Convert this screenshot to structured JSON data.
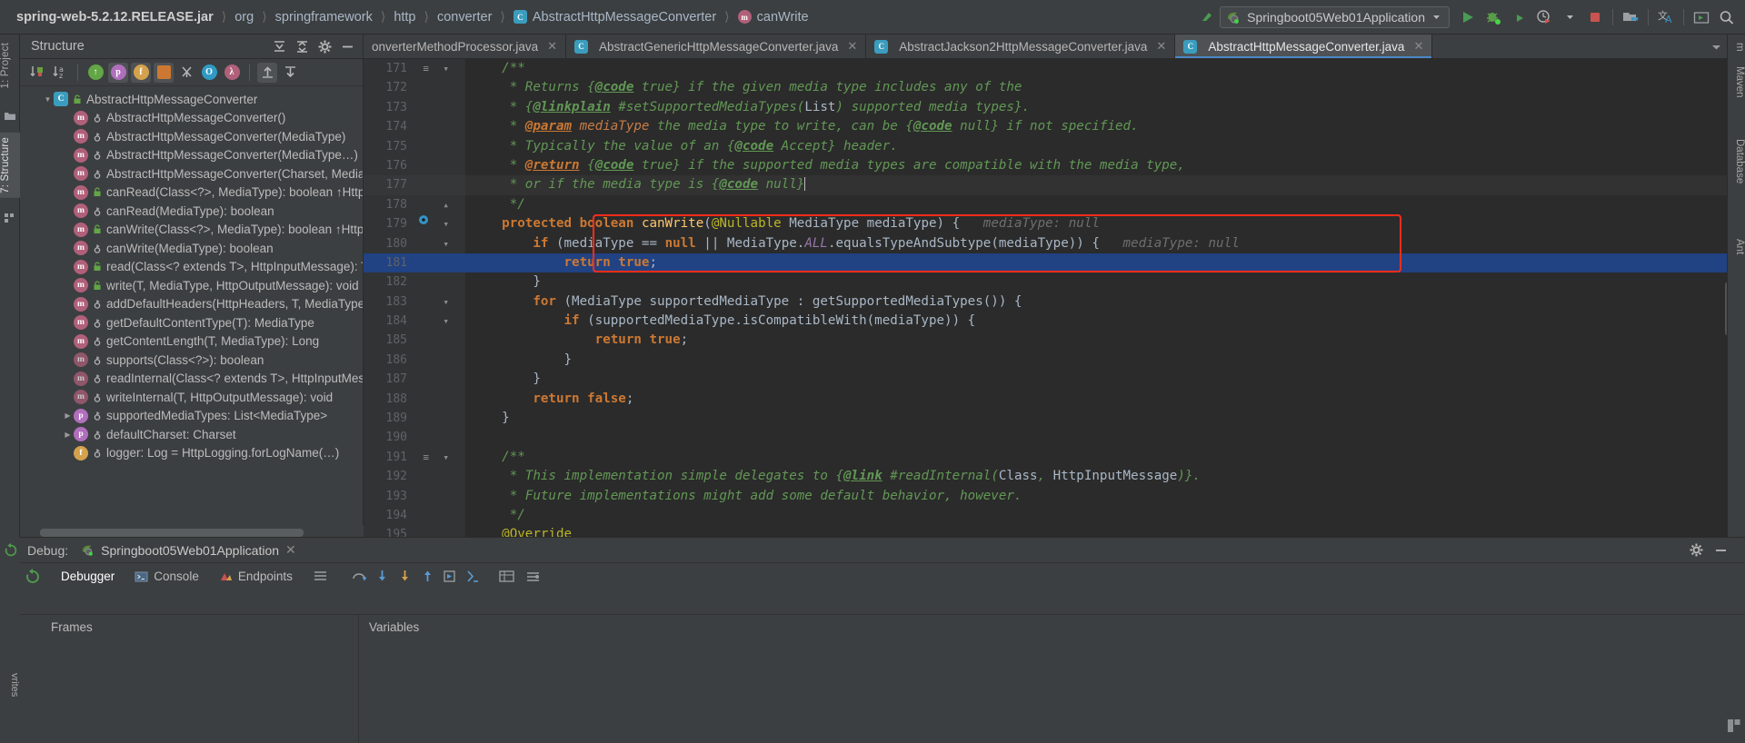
{
  "navbar": {
    "breadcrumbs": [
      {
        "label": "spring-web-5.2.12.RELEASE.jar",
        "icon": "",
        "bold": true
      },
      {
        "label": "org",
        "icon": ""
      },
      {
        "label": "springframework",
        "icon": ""
      },
      {
        "label": "http",
        "icon": ""
      },
      {
        "label": "converter",
        "icon": ""
      },
      {
        "label": "AbstractHttpMessageConverter",
        "icon": "class-icon"
      },
      {
        "label": "canWrite",
        "icon": "method-icon"
      }
    ],
    "run_config": "Springboot05Web01Application",
    "buttons": [
      {
        "name": "back-arrow-icon"
      },
      {
        "name": "run-button",
        "label": "Run"
      },
      {
        "name": "debug-button",
        "label": "Debug"
      },
      {
        "name": "run-coverage-button",
        "label": "Run with Coverage"
      },
      {
        "name": "profiler-button",
        "label": "Profiler"
      },
      {
        "name": "stop-button",
        "label": "Stop"
      },
      {
        "name": "project-structure-button",
        "label": "Project Structure"
      },
      {
        "name": "translate-button",
        "label": "Translate"
      },
      {
        "name": "terminal-button",
        "label": "Terminal"
      },
      {
        "name": "search-everywhere-button",
        "label": "Search"
      }
    ]
  },
  "left_tool_strip": [
    {
      "label": "1: Project",
      "selected": false
    },
    {
      "label": "7: Structure",
      "selected": true
    }
  ],
  "right_tool_strip": [
    {
      "label": "m",
      "selected": false
    },
    {
      "label": "Maven",
      "selected": false
    },
    {
      "label": "Database",
      "selected": false
    },
    {
      "label": "Ant",
      "selected": false
    }
  ],
  "structure": {
    "title": "Structure",
    "header_icons": [
      "expand-all-icon",
      "collapse-all-icon",
      "settings-icon",
      "hide-icon"
    ],
    "toolbar_icons": [
      "sort-by-visibility-icon",
      "sort-alphabetically-icon",
      "show-inherited-icon",
      "show-properties-icon",
      "show-fields-icon",
      "show-non-public-icon",
      "show-anonymous-icon",
      "show-interfaces-icon",
      "show-lambdas-icon",
      "expand-all-icon",
      "collapse-all-icon"
    ],
    "root": {
      "label": "AbstractHttpMessageConverter",
      "icon": "class-icon",
      "expanded": true
    },
    "items": [
      {
        "label": "AbstractHttpMessageConverter()",
        "icon": "method-icon",
        "vis": "protected",
        "indent": 1
      },
      {
        "label": "AbstractHttpMessageConverter(MediaType)",
        "icon": "method-icon",
        "vis": "protected",
        "indent": 1
      },
      {
        "label": "AbstractHttpMessageConverter(MediaType…)",
        "icon": "method-icon",
        "vis": "protected",
        "indent": 1
      },
      {
        "label": "AbstractHttpMessageConverter(Charset, MediaTyp",
        "icon": "method-icon",
        "vis": "protected",
        "indent": 1
      },
      {
        "label": "canRead(Class<?>, MediaType): boolean ↑HttpMes",
        "icon": "method-icon",
        "vis": "public",
        "indent": 1
      },
      {
        "label": "canRead(MediaType): boolean",
        "icon": "method-icon",
        "vis": "protected",
        "indent": 1
      },
      {
        "label": "canWrite(Class<?>, MediaType): boolean ↑HttpMes",
        "icon": "method-icon",
        "vis": "public",
        "indent": 1
      },
      {
        "label": "canWrite(MediaType): boolean",
        "icon": "method-icon",
        "vis": "protected",
        "indent": 1
      },
      {
        "label": "read(Class<? extends T>, HttpInputMessage): T ↑H",
        "icon": "method-icon",
        "vis": "public",
        "indent": 1
      },
      {
        "label": "write(T, MediaType, HttpOutputMessage): void ↑H",
        "icon": "method-icon",
        "vis": "public",
        "indent": 1
      },
      {
        "label": "addDefaultHeaders(HttpHeaders, T, MediaType): v",
        "icon": "method-icon",
        "vis": "protected",
        "indent": 1
      },
      {
        "label": "getDefaultContentType(T): MediaType",
        "icon": "method-icon",
        "vis": "protected",
        "indent": 1
      },
      {
        "label": "getContentLength(T, MediaType): Long",
        "icon": "method-icon",
        "vis": "protected",
        "indent": 1
      },
      {
        "label": "supports(Class<?>): boolean",
        "icon": "method-abstract-icon",
        "vis": "protected",
        "indent": 1
      },
      {
        "label": "readInternal(Class<? extends T>, HttpInputMessage",
        "icon": "method-abstract-icon",
        "vis": "protected",
        "indent": 1
      },
      {
        "label": "writeInternal(T, HttpOutputMessage): void",
        "icon": "method-abstract-icon",
        "vis": "protected",
        "indent": 1
      },
      {
        "label": "supportedMediaTypes: List<MediaType>",
        "icon": "property-icon",
        "vis": "private",
        "indent": 1,
        "arrow": true
      },
      {
        "label": "defaultCharset: Charset",
        "icon": "property-icon",
        "vis": "private",
        "indent": 1,
        "arrow": true
      },
      {
        "label": "logger: Log = HttpLogging.forLogName(…)",
        "icon": "field-icon",
        "vis": "protected",
        "indent": 1
      }
    ]
  },
  "editor": {
    "tabs": [
      {
        "label": "onverterMethodProcessor.java",
        "icon": "",
        "active": false,
        "closable": true
      },
      {
        "label": "AbstractGenericHttpMessageConverter.java",
        "icon": "class-icon",
        "active": false,
        "closable": true
      },
      {
        "label": "AbstractJackson2HttpMessageConverter.java",
        "icon": "class-icon",
        "active": false,
        "closable": true
      },
      {
        "label": "AbstractHttpMessageConverter.java",
        "icon": "class-icon",
        "active": true,
        "closable": true
      }
    ],
    "first_line": 171,
    "selected_line": 181,
    "lines": [
      {
        "n": 171,
        "fold": "start",
        "marks": [
          "doc-fold-icon"
        ],
        "tokens": [
          {
            "t": "    ",
            "c": ""
          },
          {
            "t": "/**",
            "c": "cmt"
          }
        ]
      },
      {
        "n": 172,
        "tokens": [
          {
            "t": "     * Returns ",
            "c": "cmt"
          },
          {
            "t": "{",
            "c": "cmt"
          },
          {
            "t": "@code",
            "c": "tag"
          },
          {
            "t": " true} if the given media type includes any of the",
            "c": "cmt"
          }
        ]
      },
      {
        "n": 173,
        "tokens": [
          {
            "t": "     * ",
            "c": "cmt"
          },
          {
            "t": "{",
            "c": "cmt"
          },
          {
            "t": "@linkplain",
            "c": "tag"
          },
          {
            "t": " #setSupportedMediaTypes(",
            "c": "cmt"
          },
          {
            "t": "List",
            "c": "typ"
          },
          {
            "t": ") supported media types}.",
            "c": "cmt"
          }
        ]
      },
      {
        "n": 174,
        "tokens": [
          {
            "t": "     * ",
            "c": "cmt"
          },
          {
            "t": "@param",
            "c": "tagp"
          },
          {
            "t": " ",
            "c": "cmt"
          },
          {
            "t": "mediaType",
            "c": "pname"
          },
          {
            "t": " the media type to write, can be ",
            "c": "cmt"
          },
          {
            "t": "{",
            "c": "cmt"
          },
          {
            "t": "@code",
            "c": "tag"
          },
          {
            "t": " null} if not specified.",
            "c": "cmt"
          }
        ]
      },
      {
        "n": 175,
        "tokens": [
          {
            "t": "     * Typically the value of an ",
            "c": "cmt"
          },
          {
            "t": "{",
            "c": "cmt"
          },
          {
            "t": "@code",
            "c": "tag"
          },
          {
            "t": " Accept} header.",
            "c": "cmt"
          }
        ]
      },
      {
        "n": 176,
        "tokens": [
          {
            "t": "     * ",
            "c": "cmt"
          },
          {
            "t": "@return",
            "c": "tagp"
          },
          {
            "t": " ",
            "c": "cmt"
          },
          {
            "t": "{",
            "c": "cmt"
          },
          {
            "t": "@code",
            "c": "tag"
          },
          {
            "t": " true} if the supported media types are compatible with the media type,",
            "c": "cmt"
          }
        ]
      },
      {
        "n": 177,
        "current": true,
        "tokens": [
          {
            "t": "     * or if the media type is ",
            "c": "cmt"
          },
          {
            "t": "{",
            "c": "cmt"
          },
          {
            "t": "@code",
            "c": "tag"
          },
          {
            "t": " null}",
            "c": "cmt"
          }
        ]
      },
      {
        "n": 178,
        "fold": "end",
        "tokens": [
          {
            "t": "     */",
            "c": "cmt"
          }
        ]
      },
      {
        "n": 179,
        "gutter_icon": "breakpoint-method-icon",
        "fold": "start",
        "tokens": [
          {
            "t": "    ",
            "c": ""
          },
          {
            "t": "protected",
            "c": "kw"
          },
          {
            "t": " ",
            "c": ""
          },
          {
            "t": "boolean",
            "c": "kw"
          },
          {
            "t": " ",
            "c": ""
          },
          {
            "t": "canWrite",
            "c": "mth2"
          },
          {
            "t": "(",
            "c": ""
          },
          {
            "t": "@Nullable",
            "c": "ann"
          },
          {
            "t": " MediaType mediaType) {",
            "c": ""
          },
          {
            "t": "   mediaType: null",
            "c": "hint"
          }
        ]
      },
      {
        "n": 180,
        "fold": "start",
        "boxed": true,
        "tokens": [
          {
            "t": "        ",
            "c": ""
          },
          {
            "t": "if",
            "c": "kw"
          },
          {
            "t": " (mediaType == ",
            "c": ""
          },
          {
            "t": "null",
            "c": "kw"
          },
          {
            "t": " || MediaType.",
            "c": ""
          },
          {
            "t": "ALL",
            "c": "stat"
          },
          {
            "t": ".equalsTypeAndSubtype(mediaType)) {",
            "c": ""
          },
          {
            "t": "   mediaType: null",
            "c": "hint"
          }
        ]
      },
      {
        "n": 181,
        "selected": true,
        "boxed": true,
        "tokens": [
          {
            "t": "            ",
            "c": ""
          },
          {
            "t": "return",
            "c": "kw"
          },
          {
            "t": " ",
            "c": ""
          },
          {
            "t": "true",
            "c": "kw"
          },
          {
            "t": ";",
            "c": ""
          }
        ]
      },
      {
        "n": 182,
        "boxed": true,
        "tokens": [
          {
            "t": "        }",
            "c": ""
          }
        ]
      },
      {
        "n": 183,
        "fold": "start",
        "tokens": [
          {
            "t": "        ",
            "c": ""
          },
          {
            "t": "for",
            "c": "kw"
          },
          {
            "t": " (MediaType supportedMediaType : getSupportedMediaTypes()) {",
            "c": ""
          }
        ]
      },
      {
        "n": 184,
        "fold": "start",
        "tokens": [
          {
            "t": "            ",
            "c": ""
          },
          {
            "t": "if",
            "c": "kw"
          },
          {
            "t": " (supportedMediaType.isCompatibleWith(mediaType)) {",
            "c": ""
          }
        ]
      },
      {
        "n": 185,
        "tokens": [
          {
            "t": "                ",
            "c": ""
          },
          {
            "t": "return",
            "c": "kw"
          },
          {
            "t": " ",
            "c": ""
          },
          {
            "t": "true",
            "c": "kw"
          },
          {
            "t": ";",
            "c": ""
          }
        ]
      },
      {
        "n": 186,
        "tokens": [
          {
            "t": "            }",
            "c": ""
          }
        ]
      },
      {
        "n": 187,
        "tokens": [
          {
            "t": "        }",
            "c": ""
          }
        ]
      },
      {
        "n": 188,
        "tokens": [
          {
            "t": "        ",
            "c": ""
          },
          {
            "t": "return",
            "c": "kw"
          },
          {
            "t": " ",
            "c": ""
          },
          {
            "t": "false",
            "c": "kw"
          },
          {
            "t": ";",
            "c": ""
          }
        ]
      },
      {
        "n": 189,
        "tokens": [
          {
            "t": "    }",
            "c": ""
          }
        ]
      },
      {
        "n": 190,
        "tokens": [
          {
            "t": "",
            "c": ""
          }
        ]
      },
      {
        "n": 191,
        "fold": "start",
        "marks": [
          "doc-fold-icon"
        ],
        "tokens": [
          {
            "t": "    ",
            "c": ""
          },
          {
            "t": "/**",
            "c": "cmt"
          }
        ]
      },
      {
        "n": 192,
        "tokens": [
          {
            "t": "     * This implementation simple delegates to ",
            "c": "cmt"
          },
          {
            "t": "{",
            "c": "cmt"
          },
          {
            "t": "@link",
            "c": "tag"
          },
          {
            "t": " #readInternal(",
            "c": "cmt"
          },
          {
            "t": "Class",
            "c": "typ"
          },
          {
            "t": ", ",
            "c": "cmt"
          },
          {
            "t": "HttpInputMessage",
            "c": "typ"
          },
          {
            "t": ")}.",
            "c": "cmt"
          }
        ]
      },
      {
        "n": 193,
        "tokens": [
          {
            "t": "     * Future implementations might add some default behavior, however.",
            "c": "cmt"
          }
        ]
      },
      {
        "n": 194,
        "tokens": [
          {
            "t": "     */",
            "c": "cmt"
          }
        ]
      },
      {
        "n": 195,
        "tokens": [
          {
            "t": "    ",
            "c": ""
          },
          {
            "t": "@Override",
            "c": "ann"
          }
        ]
      }
    ]
  },
  "debug": {
    "label": "Debug:",
    "config": "Springboot05Web01Application",
    "tabs": [
      {
        "label": "Debugger",
        "icon": "",
        "active": true
      },
      {
        "label": "Console",
        "icon": "console-icon",
        "active": false
      },
      {
        "label": "Endpoints",
        "icon": "endpoints-icon",
        "active": false
      }
    ],
    "toolbar_icons": [
      "layout-icon",
      "step-over-icon",
      "step-into-icon",
      "force-step-into-icon",
      "step-out-icon",
      "run-to-cursor-icon",
      "evaluate-expression-icon",
      "watches-icon",
      "settings-icon"
    ],
    "frames_title": "Frames",
    "variables_title": "Variables",
    "header_icons": [
      "settings-icon",
      "minimize-icon"
    ],
    "rerun_icon": "rerun-icon",
    "bottom_right_icon": "layout-settings-icon"
  },
  "colors": {
    "bg": "#3c3f41",
    "editor_bg": "#2b2b2b",
    "gutter_bg": "#313335",
    "selection": "#214283",
    "accent_blue": "#4a88c7",
    "red_box": "#ff2d1a",
    "comment_green": "#629755",
    "keyword_orange": "#cc7832",
    "method_yellow": "#ffc66d",
    "annotation_yellow": "#bbb529",
    "static_purple": "#9876aa",
    "text": "#a9b7c6"
  }
}
